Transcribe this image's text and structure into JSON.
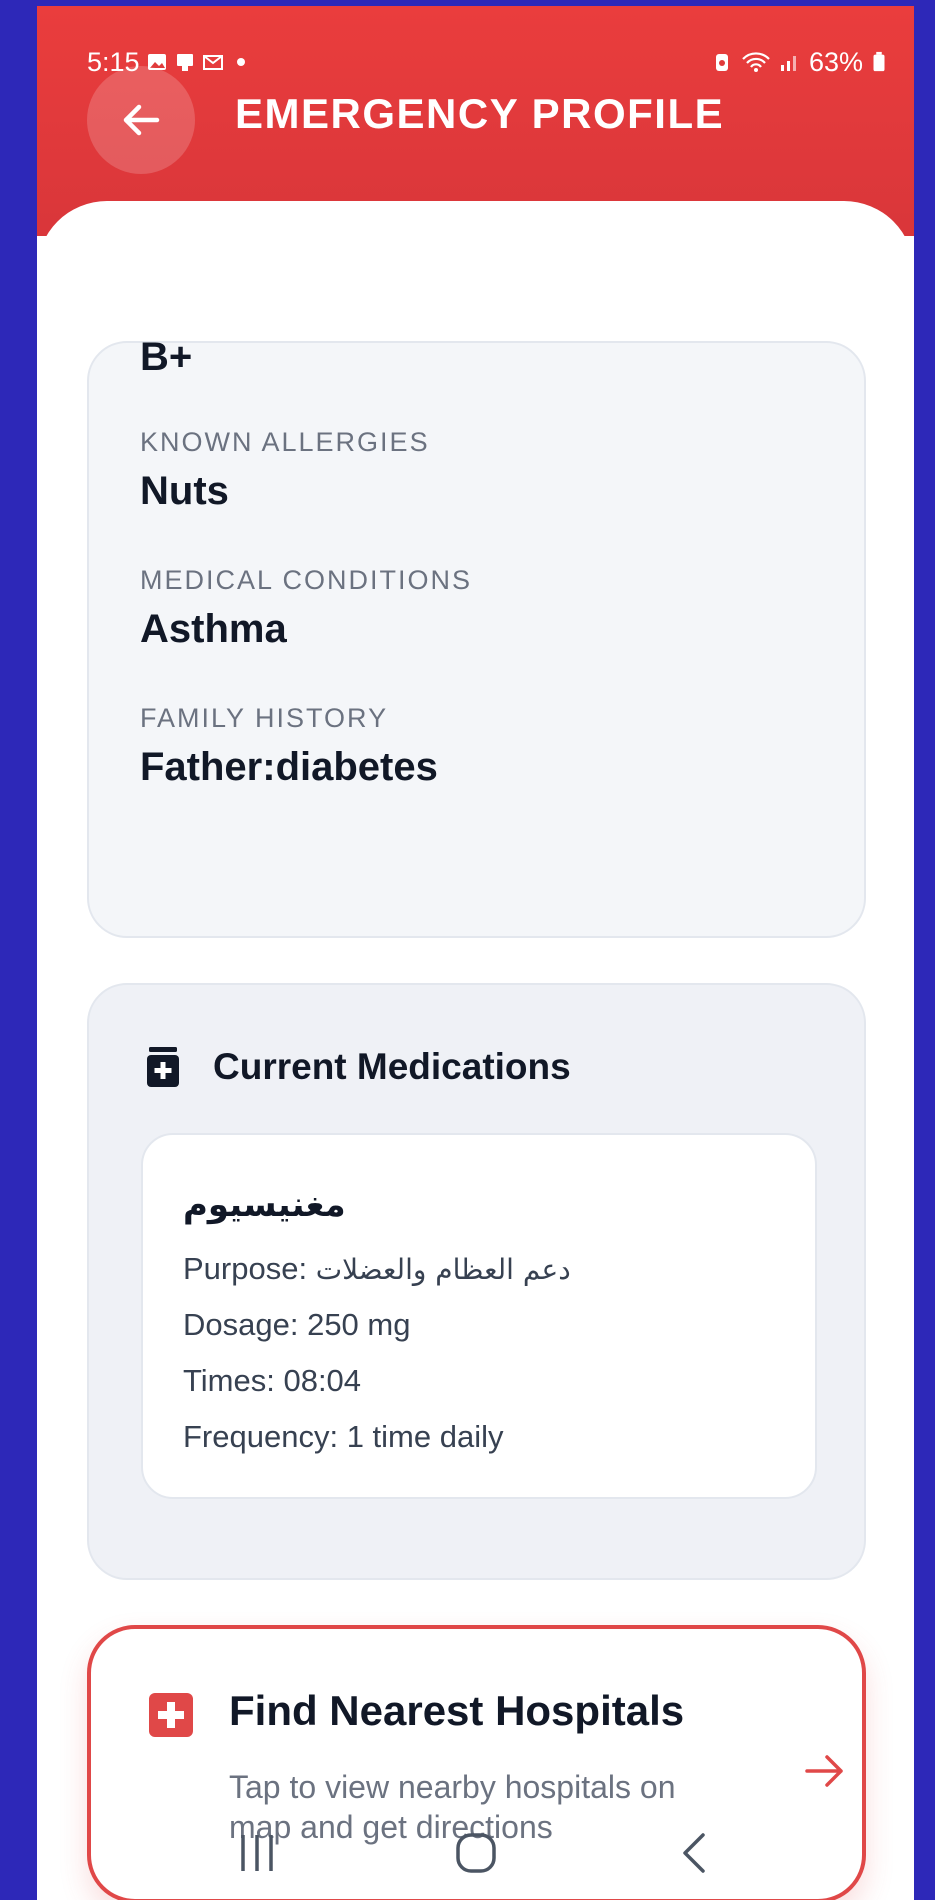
{
  "status_bar": {
    "time": "5:15",
    "battery": "63%"
  },
  "header": {
    "title": "EMERGENCY PROFILE"
  },
  "profile": {
    "blood_type_value": "B+",
    "allergies_label": "KNOWN ALLERGIES",
    "allergies_value": "Nuts",
    "conditions_label": "MEDICAL CONDITIONS",
    "conditions_value": "Asthma",
    "family_label": "FAMILY HISTORY",
    "family_value": "Father:diabetes"
  },
  "medications": {
    "title": "Current Medications",
    "items": [
      {
        "name": "مغنيسيوم",
        "purpose_label": "Purpose:",
        "purpose_value": "دعم العظام والعضلات",
        "dosage": "Dosage: 250 mg",
        "times": "Times: 08:04",
        "frequency": "Frequency: 1 time daily"
      }
    ]
  },
  "hospitals": {
    "title": "Find Nearest Hospitals",
    "description": "Tap to view nearby hospitals on map and get directions"
  },
  "colors": {
    "header_red": "#e53e3e",
    "accent_red": "#e04848",
    "outer_background": "#2d28b8"
  },
  "icons": {
    "back": "arrow-left-icon",
    "medications": "medicine-bottle-icon",
    "hospital": "hospital-cross-icon",
    "go": "arrow-right-icon"
  }
}
